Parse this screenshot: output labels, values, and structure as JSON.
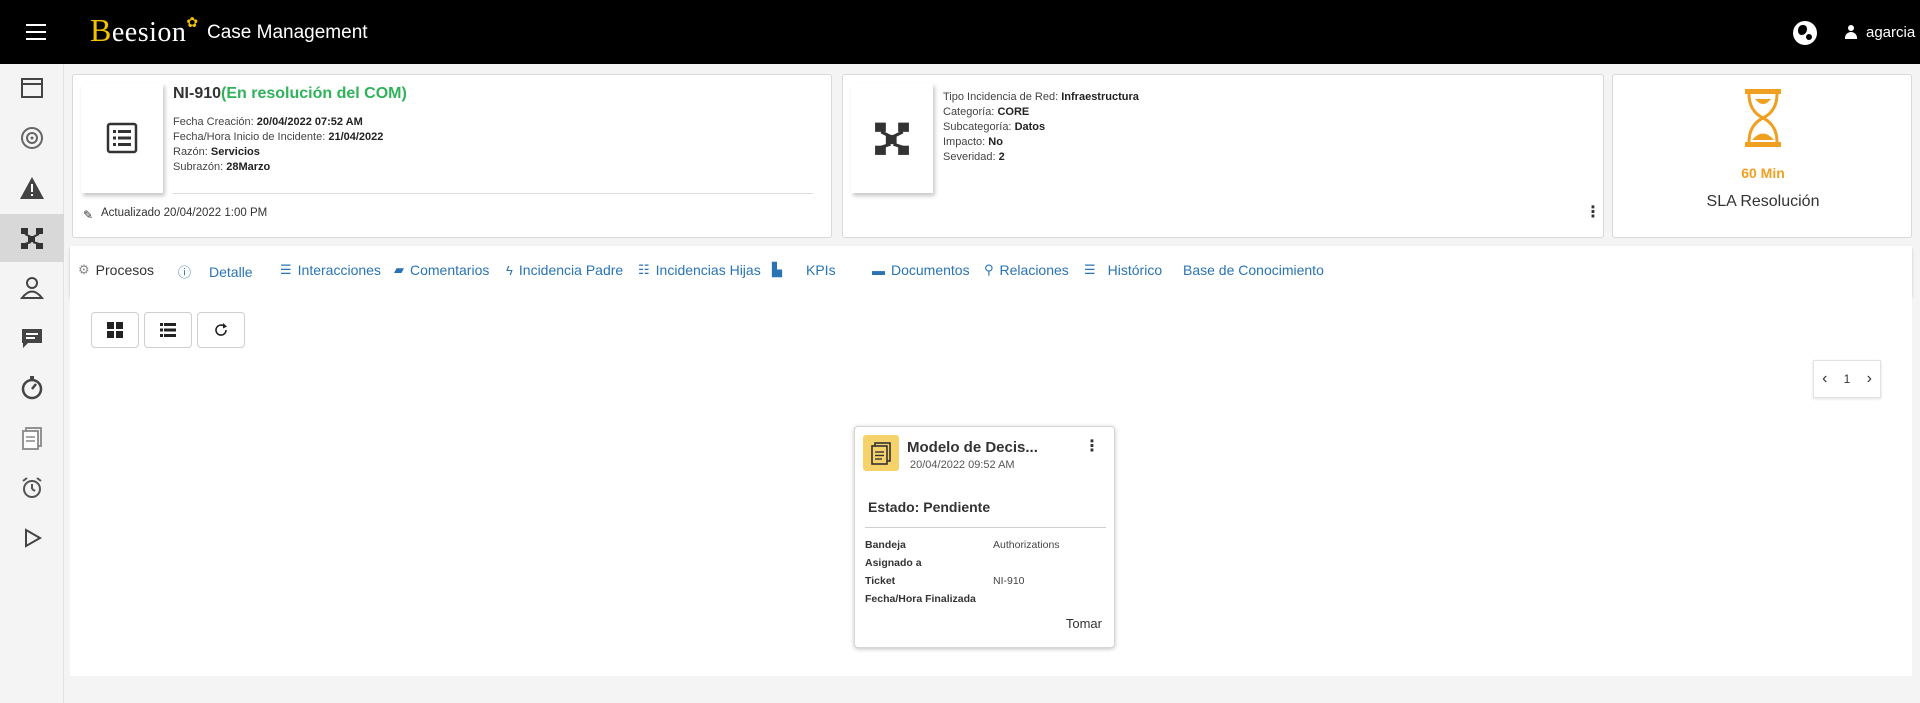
{
  "app": {
    "logo_text": "eesion",
    "logo_initial": "B",
    "title": "Case Management",
    "user": "agarcia"
  },
  "sidebar": {
    "items": [
      {
        "icon": "calendar-icon"
      },
      {
        "icon": "target-icon"
      },
      {
        "icon": "warning-icon"
      },
      {
        "icon": "network-icon",
        "active": true
      },
      {
        "icon": "users-icon"
      },
      {
        "icon": "chat-icon"
      },
      {
        "icon": "timer-icon"
      },
      {
        "icon": "documents-icon"
      },
      {
        "icon": "alarm-icon"
      },
      {
        "icon": "play-icon"
      }
    ]
  },
  "case": {
    "id": "NI-910",
    "status": "(En resolución del COM)",
    "fields": [
      {
        "label": "Fecha Creación:",
        "value": "20/04/2022 07:52 AM"
      },
      {
        "label": "Fecha/Hora Inicio de Incidente:",
        "value": "21/04/2022"
      },
      {
        "label": "Razón:",
        "value": "Servicios"
      },
      {
        "label": "Subrazón:",
        "value": "28Marzo"
      }
    ],
    "updated": "Actualizado 20/04/2022 1:00 PM"
  },
  "classification": {
    "fields": [
      {
        "label": "Tipo Incidencia de Red:",
        "value": "Infraestructura"
      },
      {
        "label": "Categoría:",
        "value": "CORE"
      },
      {
        "label": "Subcategoría:",
        "value": "Datos"
      },
      {
        "label": "Impacto:",
        "value": "No"
      },
      {
        "label": "Severidad:",
        "value": "2"
      }
    ]
  },
  "sla": {
    "value": "60 Min",
    "label": "SLA Resolución",
    "color": "#f0a020"
  },
  "tabs": [
    {
      "label": "Procesos",
      "icon": "gear-icon",
      "active": true
    },
    {
      "label": "Detalle",
      "icon": "info-icon"
    },
    {
      "label": "Interacciones",
      "icon": "list-icon"
    },
    {
      "label": "Comentarios",
      "icon": "comment-icon"
    },
    {
      "label": "Incidencia Padre",
      "icon": "bolt-icon"
    },
    {
      "label": "Incidencias Hijas",
      "icon": "tree-list-icon"
    },
    {
      "label": "KPIs",
      "icon": "bar-chart-icon"
    },
    {
      "label": "Documentos",
      "icon": "folder-icon"
    },
    {
      "label": "Relaciones",
      "icon": "link-icon"
    },
    {
      "label": "Histórico",
      "icon": "history-icon"
    },
    {
      "label": "Base de Conocimiento",
      "icon": ""
    }
  ],
  "pager": {
    "page": "1"
  },
  "task_card": {
    "title": "Modelo de Decis...",
    "date": "20/04/2022 09:52 AM",
    "state": "Estado: Pendiente",
    "rows": [
      {
        "k": "Bandeja",
        "v": "Authorizations"
      },
      {
        "k": "Asignado a",
        "v": ""
      },
      {
        "k": "Ticket",
        "v": "NI-910"
      },
      {
        "k": "Fecha/Hora Finalizada",
        "v": ""
      }
    ],
    "action": "Tomar"
  },
  "colors": {
    "accent": "#2a74b4",
    "status_green": "#2fb35a",
    "topbar": "#000000"
  }
}
